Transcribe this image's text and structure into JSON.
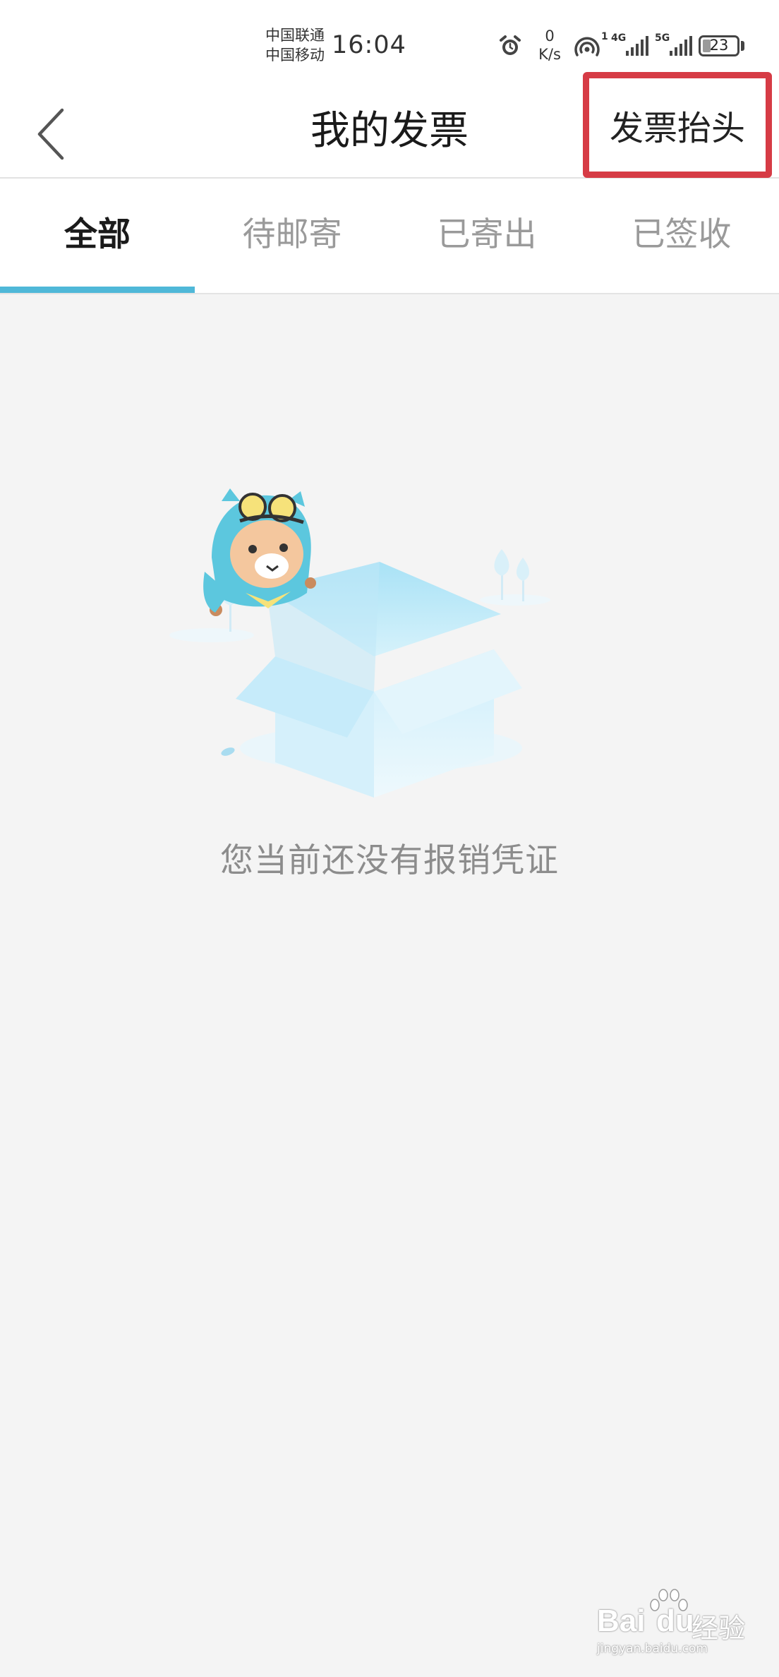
{
  "status_bar": {
    "carrier_1": "中国联通",
    "carrier_2": "中国移动",
    "time": "16:04",
    "net_speed_value": "0",
    "net_speed_unit": "K/s",
    "hotspot_badge": "1",
    "sim1_network": "4G",
    "sim2_network": "5G",
    "battery_level": "23",
    "battery_percent": 23
  },
  "nav": {
    "title": "我的发票",
    "right_button": "发票抬头"
  },
  "tabs": [
    {
      "label": "全部",
      "active": true
    },
    {
      "label": "待邮寄",
      "active": false
    },
    {
      "label": "已寄出",
      "active": false
    },
    {
      "label": "已签收",
      "active": false
    }
  ],
  "empty_state": {
    "message": "您当前还没有报销凭证"
  },
  "watermark": {
    "brand": "Bai",
    "brand_tail": "du",
    "service": "经验",
    "domain": "jingyan.baidu.com"
  },
  "colors": {
    "accent": "#4fb8d8",
    "highlight_border": "#d63b45",
    "background": "#f4f4f4"
  }
}
